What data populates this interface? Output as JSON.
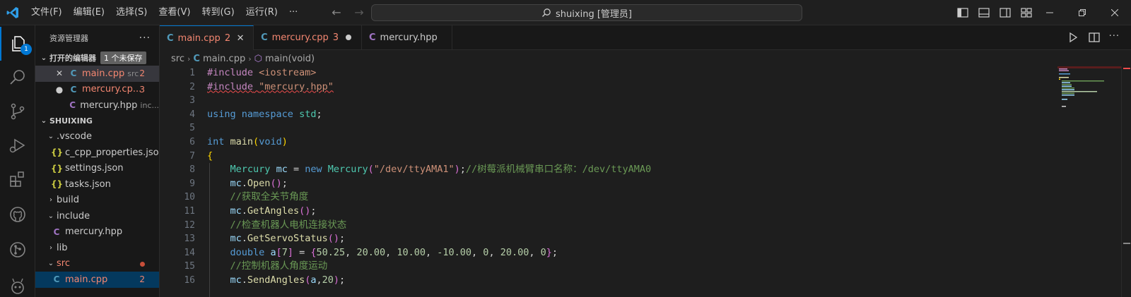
{
  "menu": [
    "文件(F)",
    "编辑(E)",
    "选择(S)",
    "查看(V)",
    "转到(G)",
    "运行(R)",
    "···"
  ],
  "search": {
    "text": "shuixing [管理员]"
  },
  "activity": {
    "explorer_badge": "1"
  },
  "sidebar": {
    "title": "资源管理器",
    "more": "···",
    "open_editors_title": "打开的编辑器",
    "unsaved_badge": "1 个未保存",
    "open_editors": [
      {
        "name": "main.cpp",
        "desc": "src",
        "count": "2",
        "marker": "✕"
      },
      {
        "name": "mercury.cp...",
        "desc": "",
        "count": "3",
        "marker": "●"
      },
      {
        "name": "mercury.hpp",
        "desc": "inc...",
        "count": "",
        "marker": ""
      }
    ],
    "workspace_title": "SHUIXING",
    "tree": {
      "vscode": ".vscode",
      "c_cpp": "c_cpp_properties.json",
      "settings": "settings.json",
      "tasks": "tasks.json",
      "build": "build",
      "include": "include",
      "mercury_hpp": "mercury.hpp",
      "lib": "lib",
      "src": "src",
      "main_cpp": "main.cpp",
      "main_cpp_count": "2"
    }
  },
  "tabs": [
    {
      "name": "main.cpp",
      "count": "2"
    },
    {
      "name": "mercury.cpp",
      "count": "3"
    },
    {
      "name": "mercury.hpp",
      "count": ""
    }
  ],
  "breadcrumb": {
    "folder": "src",
    "file": "main.cpp",
    "symbol": "main(void)"
  },
  "editor": {
    "line_numbers": [
      "1",
      "2",
      "3",
      "4",
      "5",
      "6",
      "7",
      "8",
      "9",
      "10",
      "11",
      "12",
      "13",
      "14",
      "15",
      "16"
    ],
    "code": {
      "l1_pre": "#include",
      "l1_rest": " <iostream>",
      "l2_pre": "#include",
      "l2_str": "\"mercury.hpp\"",
      "l4_a": "using",
      "l4_b": "namespace",
      "l4_c": "std",
      "l6_kw": "int",
      "l6_fn": "main",
      "l6_void": "void",
      "l7": "{",
      "l8_type": "Mercury",
      "l8_var": "mc",
      "l8_new": "new",
      "l8_type2": "Mercury",
      "l8_str": "\"/dev/ttyAMA1\"",
      "l8_cm": "//树莓派机械臂串口名称：/dev/ttyAMA0",
      "l9_var": "mc",
      "l9_fn": "Open",
      "l10_cm": "//获取全关节角度",
      "l11_var": "mc",
      "l11_fn": "GetAngles",
      "l12_cm": "//检查机器人电机连接状态",
      "l13_var": "mc",
      "l13_fn": "GetServoStatus",
      "l14_kw": "double",
      "l14_var": "a",
      "l14_n7": "7",
      "l14_vals": [
        "50.25",
        "20.00",
        "10.00",
        "-10.00",
        "0",
        "20.00",
        "0"
      ],
      "l15_cm": "//控制机器人角度运动",
      "l16_var": "mc",
      "l16_fn": "SendAngles",
      "l16_a": "a",
      "l16_n": "20"
    }
  },
  "colors": {
    "accent": "#0078d4",
    "error": "#f48771",
    "background": "#1e1e1e"
  }
}
